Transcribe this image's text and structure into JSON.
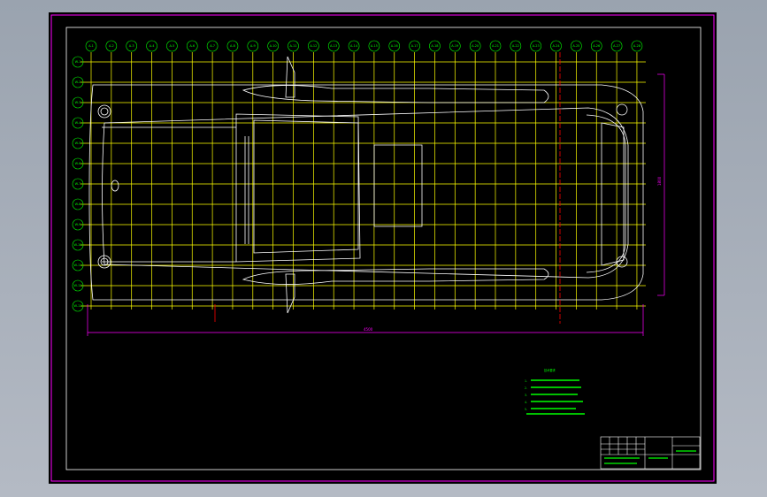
{
  "drawing": {
    "column_labels": [
      "A-1",
      "A-2",
      "A-3",
      "A-4",
      "A-5",
      "A-6",
      "A-7",
      "A-8",
      "A-9",
      "A-10",
      "A-11",
      "A-12",
      "A-13",
      "A-14",
      "A-15",
      "A-16",
      "A-17",
      "A-18",
      "A-19",
      "A-20",
      "A-21",
      "A-22",
      "A-23",
      "A-24",
      "A-25",
      "A-26",
      "A-27",
      "A-28"
    ],
    "row_labels": [
      "W-1",
      "W-2",
      "W-3",
      "W-4",
      "W-5",
      "W-6",
      "W-7",
      "W-8",
      "W-9",
      "W-10",
      "W-11",
      "W-12",
      "W-13"
    ],
    "dimension_horizontal": "4500",
    "dimension_vertical": "1800",
    "notes_title": "技术要求",
    "notes": [
      "1.",
      "2.",
      "3.",
      "4.",
      "5."
    ],
    "title_block": {
      "cells": [
        "",
        "",
        "",
        "",
        "",
        ""
      ]
    },
    "colors": {
      "frame": "#ff00ff",
      "grid": "#ffff00",
      "outline": "#ffffff",
      "centerline": "#ff0000",
      "bubble": "#00ff00"
    }
  }
}
